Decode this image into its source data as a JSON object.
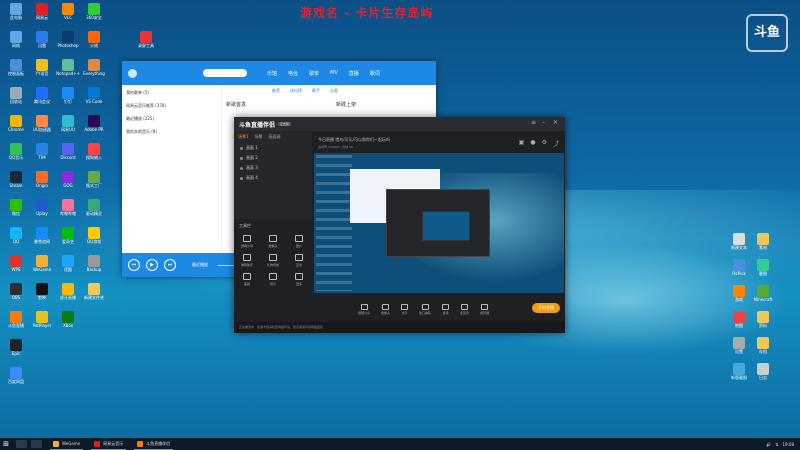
{
  "overlay": {
    "stream_title": "游戏名 - 卡片生存岛屿",
    "corner_logo": "斗鱼"
  },
  "desktop": {
    "icons": [
      {
        "label": "此电脑",
        "color": "#5fa8e8",
        "col": 0,
        "row": 0
      },
      {
        "label": "网络",
        "color": "#5fa8e8",
        "col": 0,
        "row": 1
      },
      {
        "label": "控制面板",
        "color": "#4a8fd8",
        "col": 0,
        "row": 2
      },
      {
        "label": "回收站",
        "color": "#9ab",
        "col": 0,
        "row": 3
      },
      {
        "label": "Chrome",
        "color": "#f4b400",
        "col": 0,
        "row": 4
      },
      {
        "label": "QQ音乐",
        "color": "#30c060",
        "col": 0,
        "row": 5
      },
      {
        "label": "Steam",
        "color": "#1b2838",
        "col": 0,
        "row": 6
      },
      {
        "label": "微信",
        "color": "#2dc100",
        "col": 0,
        "row": 7
      },
      {
        "label": "QQ",
        "color": "#12b7f5",
        "col": 0,
        "row": 8
      },
      {
        "label": "WPS",
        "color": "#d33",
        "col": 0,
        "row": 9
      },
      {
        "label": "OBS",
        "color": "#302e31",
        "col": 0,
        "row": 10
      },
      {
        "label": "斗鱼直播",
        "color": "#ff7a00",
        "col": 0,
        "row": 11
      },
      {
        "label": "Epic",
        "color": "#222",
        "col": 0,
        "row": 12
      },
      {
        "label": "百度网盘",
        "color": "#3b8cff",
        "col": 0,
        "row": 13
      },
      {
        "label": "网易云",
        "color": "#e02020",
        "col": 1,
        "row": 0
      },
      {
        "label": "迅雷",
        "color": "#2b7be8",
        "col": 1,
        "row": 1
      },
      {
        "label": "YY语音",
        "color": "#f0c020",
        "col": 1,
        "row": 2
      },
      {
        "label": "腾讯会议",
        "color": "#1e6fff",
        "col": 1,
        "row": 3
      },
      {
        "label": "UU加速器",
        "color": "#f84",
        "col": 1,
        "row": 4
      },
      {
        "label": "TIM",
        "color": "#2a82e4",
        "col": 1,
        "row": 5
      },
      {
        "label": "Origin",
        "color": "#f56c2d",
        "col": 1,
        "row": 6
      },
      {
        "label": "Uplay",
        "color": "#1c5ccf",
        "col": 1,
        "row": 7
      },
      {
        "label": "暴雪战网",
        "color": "#148eff",
        "col": 1,
        "row": 8
      },
      {
        "label": "WeGame",
        "color": "#f2b134",
        "col": 1,
        "row": 9
      },
      {
        "label": "剪映",
        "color": "#111",
        "col": 1,
        "row": 10
      },
      {
        "label": "PotPlayer",
        "color": "#e7c21d",
        "col": 1,
        "row": 11
      },
      {
        "label": "VLC",
        "color": "#f80",
        "col": 2,
        "row": 0
      },
      {
        "label": "Photoshop",
        "color": "#0a3b6e",
        "col": 2,
        "row": 1
      },
      {
        "label": "Notepad++",
        "color": "#6b9",
        "col": 2,
        "row": 2
      },
      {
        "label": "钉钉",
        "color": "#1a8cff",
        "col": 2,
        "row": 3
      },
      {
        "label": "网易UU",
        "color": "#3bc",
        "col": 2,
        "row": 4
      },
      {
        "label": "Discord",
        "color": "#5865f2",
        "col": 2,
        "row": 5
      },
      {
        "label": "GOG",
        "color": "#8a2be2",
        "col": 2,
        "row": 6
      },
      {
        "label": "哔哩哔哩",
        "color": "#fb7299",
        "col": 2,
        "row": 7
      },
      {
        "label": "爱奇艺",
        "color": "#00be06",
        "col": 2,
        "row": 8
      },
      {
        "label": "优酷",
        "color": "#1fa5ff",
        "col": 2,
        "row": 9
      },
      {
        "label": "虎牙直播",
        "color": "#ffb900",
        "col": 2,
        "row": 10
      },
      {
        "label": "Xbox",
        "color": "#107c10",
        "col": 2,
        "row": 11
      },
      {
        "label": "360安全",
        "color": "#3c3",
        "col": 3,
        "row": 0
      },
      {
        "label": "火绒",
        "color": "#f60",
        "col": 3,
        "row": 1
      },
      {
        "label": "Everything",
        "color": "#d84",
        "col": 3,
        "row": 2
      },
      {
        "label": "VS Code",
        "color": "#0078d4",
        "col": 3,
        "row": 3
      },
      {
        "label": "Adobe PR",
        "color": "#2a0a4e",
        "col": 3,
        "row": 4
      },
      {
        "label": "搜狗输入",
        "color": "#f44",
        "col": 3,
        "row": 5
      },
      {
        "label": "格式工厂",
        "color": "#6a4",
        "col": 3,
        "row": 6
      },
      {
        "label": "驱动精灵",
        "color": "#3a7",
        "col": 3,
        "row": 7
      },
      {
        "label": "QQ游戏",
        "color": "#fc0",
        "col": 3,
        "row": 8
      },
      {
        "label": "Backup",
        "color": "#999",
        "col": 3,
        "row": 9
      },
      {
        "label": "录屏工具",
        "color": "#e33",
        "col": 5,
        "row": 1
      },
      {
        "label": "新建文件夹",
        "color": "#f0c85a",
        "col": 3,
        "row": 10
      }
    ],
    "right_icons": [
      {
        "label": "新建文本",
        "color": "#ddd"
      },
      {
        "label": "素材",
        "color": "#f0c85a"
      },
      {
        "label": "PicPick",
        "color": "#4a90e2"
      },
      {
        "label": "截图",
        "color": "#3c9"
      },
      {
        "label": "游戏",
        "color": "#f80"
      },
      {
        "label": "Minecraft",
        "color": "#5a3"
      },
      {
        "label": "地图",
        "color": "#e44"
      },
      {
        "label": "资料",
        "color": "#f0c85a"
      },
      {
        "label": "设置",
        "color": "#aaa"
      },
      {
        "label": "存档",
        "color": "#f0c85a"
      },
      {
        "label": "新版截图",
        "color": "#4ad"
      },
      {
        "label": "日志",
        "color": "#ccc"
      }
    ]
  },
  "music_player": {
    "tabs": [
      "乐馆",
      "电台",
      "歌单",
      "MV",
      "直播",
      "歌词"
    ],
    "subtabs": [
      "推荐",
      "排行榜",
      "歌手",
      "分类"
    ],
    "sidebar": [
      "我的歌单 (5)",
      "网易云音乐推荐 (178)",
      "最近播放 (225)",
      "我的本地音乐 (8)"
    ],
    "main_heading": "新歌首发",
    "col2_heading": "新碟上架",
    "now_playing": "最近播放"
  },
  "live_app": {
    "logo": "斗鱼直播伴侣",
    "version": "正式版",
    "room_title": "今日直播 猎鸟/可乐/可以和你们一起玩吗",
    "room_meta": "房间号 100000 · 在线 56",
    "red_label": "正在直播 00:12:35",
    "scene_tabs": [
      "场景1",
      "场景",
      "画面源"
    ],
    "scenes": [
      "画面 1",
      "画面 2",
      "画面 3",
      "画面 4"
    ],
    "tools_title": "工具栏",
    "tools": [
      "屏幕分享",
      "摄像头",
      "图片",
      "弹幕助手",
      "礼物特效",
      "互动",
      "美颜",
      "音乐",
      "更多"
    ],
    "bottom_bar": [
      "屏幕分享",
      "摄像头",
      "文字",
      "窗口捕获",
      "游戏",
      "麦克风",
      "扬声器"
    ],
    "start_button": "开始直播",
    "status": "正在推流中，如遇卡顿请检查网络环境，建议使用有线网络连接"
  },
  "taskbar": {
    "apps": [
      {
        "label": "WeGame",
        "color": "#f2b134"
      },
      {
        "label": "网易云音乐",
        "color": "#e02020"
      },
      {
        "label": "斗鱼直播伴侣",
        "color": "#ff7a00"
      }
    ],
    "time": "19:08"
  }
}
